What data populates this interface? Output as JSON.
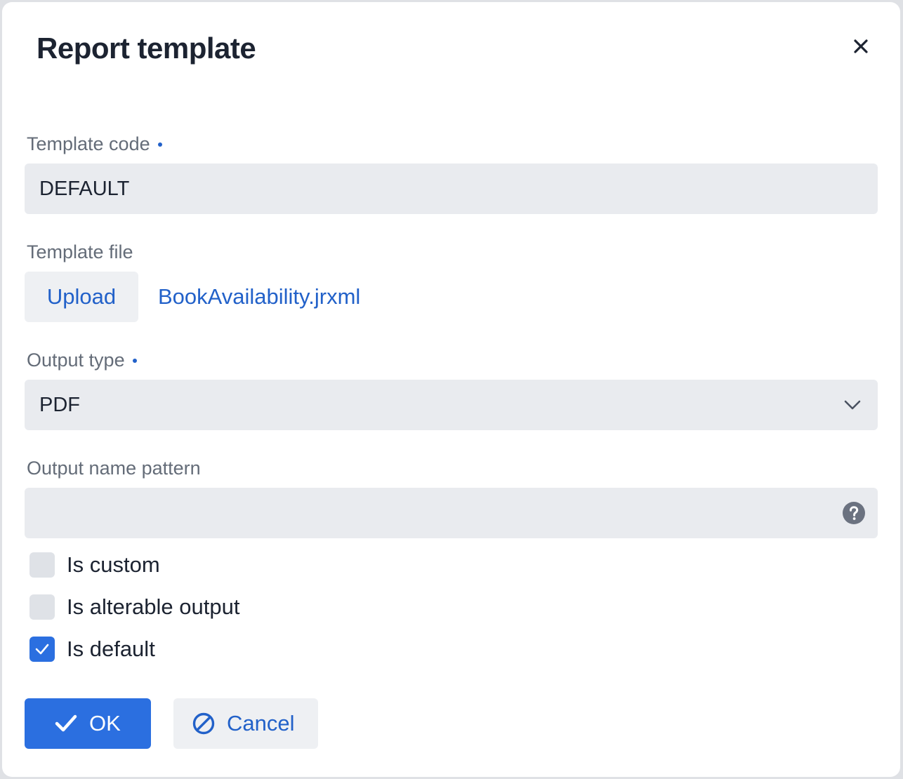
{
  "dialog": {
    "title": "Report template",
    "close_icon": "close-icon"
  },
  "template_code": {
    "label": "Template code",
    "required": true,
    "value": "DEFAULT"
  },
  "template_file": {
    "label": "Template file",
    "upload_label": "Upload",
    "file_name": "BookAvailability.jrxml"
  },
  "output_type": {
    "label": "Output type",
    "required": true,
    "value": "PDF",
    "icon": "chevron-down-icon"
  },
  "output_name_pattern": {
    "label": "Output name pattern",
    "value": "",
    "icon": "help-icon"
  },
  "checkboxes": [
    {
      "label": "Is custom",
      "checked": false
    },
    {
      "label": "Is alterable output",
      "checked": false
    },
    {
      "label": "Is default",
      "checked": true
    }
  ],
  "buttons": {
    "ok_label": "OK",
    "ok_icon": "check-icon",
    "cancel_label": "Cancel",
    "cancel_icon": "ban-icon"
  },
  "colors": {
    "accent": "#2b6fe0",
    "link": "#2261c9",
    "input_bg": "#e9ebef",
    "text": "#1c2331",
    "label": "#646c78"
  }
}
